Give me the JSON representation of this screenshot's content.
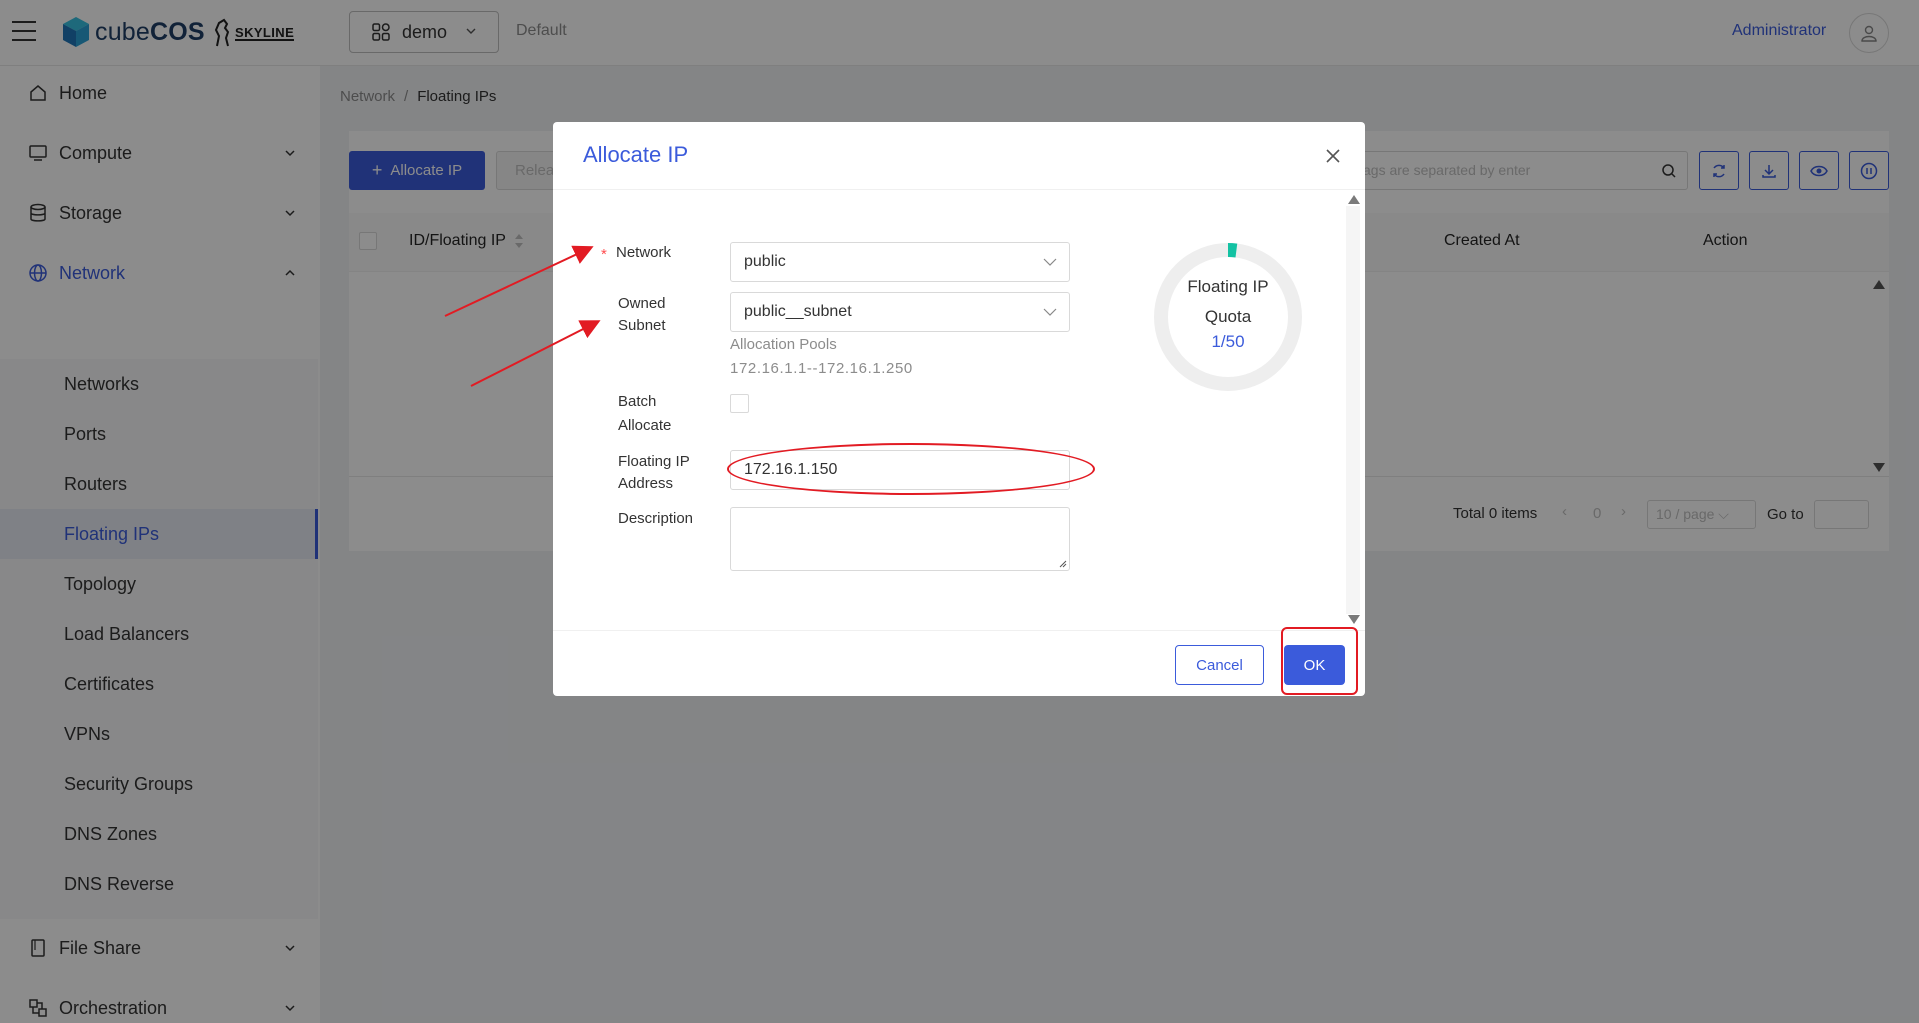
{
  "header": {
    "brand_cube": "cube",
    "brand_cos": "COS",
    "skyline": "SKYLINE",
    "project": "demo",
    "domain": "Default",
    "user": "Administrator"
  },
  "sidebar": {
    "home": "Home",
    "compute": "Compute",
    "storage": "Storage",
    "network": "Network",
    "network_items": [
      "Networks",
      "Ports",
      "Routers",
      "Floating IPs",
      "Topology",
      "Load Balancers",
      "Certificates",
      "VPNs",
      "Security Groups",
      "DNS Zones",
      "DNS Reverse"
    ],
    "file_share": "File Share",
    "orchestration": "Orchestration"
  },
  "breadcrumb": {
    "parent": "Network",
    "sep": "/",
    "current": "Floating IPs"
  },
  "toolbar": {
    "allocate": "Allocate IP",
    "release": "Release",
    "search_placeholder": "ags are separated by enter"
  },
  "table": {
    "col_id": "ID/Floating IP",
    "col_created": "Created At",
    "col_action": "Action"
  },
  "pagination": {
    "total": "Total 0 items",
    "page": "0",
    "size": "10 / page",
    "goto": "Go to"
  },
  "modal": {
    "title": "Allocate IP",
    "network_label": "Network",
    "network_value": "public",
    "subnet_label_1": "Owned",
    "subnet_label_2": "Subnet",
    "subnet_value": "public__subnet",
    "pools_label": "Allocation Pools",
    "pools_value": "172.16.1.1--172.16.1.250",
    "batch_label_1": "Batch",
    "batch_label_2": "Allocate",
    "fip_label_1": "Floating IP",
    "fip_label_2": "Address",
    "fip_value": "172.16.1.150",
    "description_label": "Description",
    "quota_title_1": "Floating IP",
    "quota_title_2": "Quota",
    "quota_value": "1/50",
    "cancel": "Cancel",
    "ok": "OK"
  },
  "quota": {
    "used": 1,
    "total": 50
  },
  "colors": {
    "accent": "#3b5bdb",
    "annotation": "#e21b23",
    "quota": "#13c2a3"
  }
}
